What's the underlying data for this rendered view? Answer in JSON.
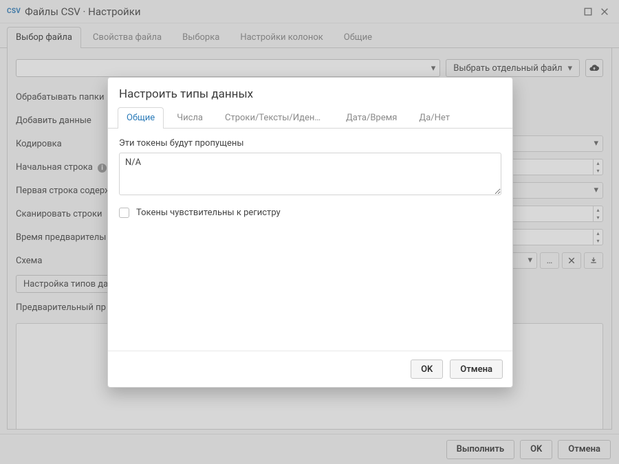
{
  "titlebar": {
    "badge": "CSV",
    "title": "Файлы CSV · Настройки"
  },
  "main_tabs": {
    "items": [
      "Выбор файла",
      "Свойства файла",
      "Выборка",
      "Настройки колонок",
      "Общие"
    ],
    "active_index": 0
  },
  "file_row": {
    "pick_label": "Выбрать отдельный файл"
  },
  "settings_labels": {
    "process_folders": "Обрабатывать папки",
    "add_data": "Добавить данные",
    "encoding": "Кодировка",
    "start_row": "Начальная строка",
    "first_row_contains": "Первая строка содерж",
    "scan_rows": "Сканировать строки",
    "prescan_time": "Время предварителы",
    "schema": "Схема",
    "configure_types_btn": "Настройка типов да",
    "preview": "Предварительный пр"
  },
  "bottom_bar": {
    "run": "Выполнить",
    "ok": "OK",
    "cancel": "Отмена"
  },
  "modal": {
    "title": "Настроить типы данных",
    "tabs": [
      "Общие",
      "Числа",
      "Строки/Тексты/Идентифик...",
      "Дата/Время",
      "Да/Нет"
    ],
    "active_index": 0,
    "tokens_label": "Эти токены будут пропущены",
    "tokens_value": "N/A",
    "case_sensitive_label": "Токены чувствительны к регистру",
    "case_sensitive_checked": false,
    "ok": "OK",
    "cancel": "Отмена"
  }
}
